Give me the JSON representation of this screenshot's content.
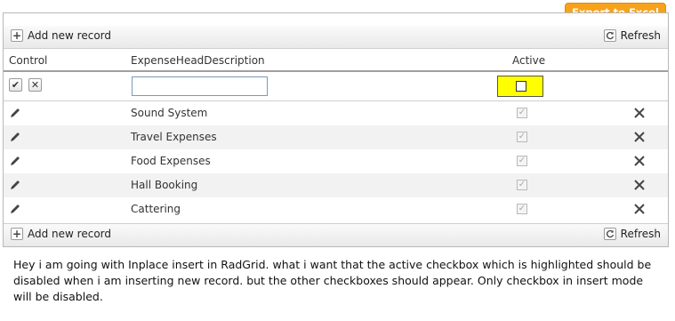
{
  "toolbar": {
    "export_label": "Export to Excel",
    "add_label": "Add new record",
    "refresh_label": "Refresh"
  },
  "columns": {
    "control": "Control",
    "description": "ExpenseHeadDescription",
    "active": "Active"
  },
  "insert_row": {
    "description_value": "",
    "active_checked": false
  },
  "rows": [
    {
      "description": "Sound System",
      "active": true
    },
    {
      "description": "Travel Expenses",
      "active": true
    },
    {
      "description": "Food Expenses",
      "active": true
    },
    {
      "description": "Hall Booking",
      "active": true
    },
    {
      "description": "Cattering",
      "active": true
    }
  ],
  "icons": {
    "edit": "pencil-icon",
    "delete": "close-icon",
    "add": "plus-icon",
    "refresh": "refresh-icon",
    "update": "check-icon",
    "cancel": "cancel-icon"
  },
  "colors": {
    "export_button": "#f7a21b",
    "highlight": "#ffff00"
  },
  "note": "Hey i am going with Inplace insert in RadGrid. what i want that the active checkbox which is highlighted should be disabled when i am inserting new record. but the other checkboxes should appear. Only checkbox in insert mode will be disabled."
}
